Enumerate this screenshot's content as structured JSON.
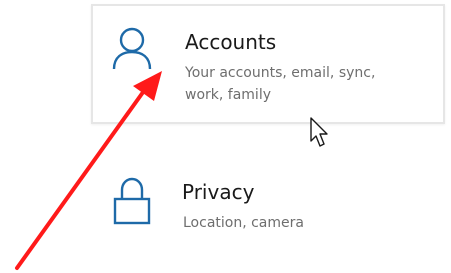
{
  "settings": {
    "accounts": {
      "title": "Accounts",
      "description_line1": "Your accounts, email, sync,",
      "description_line2": "work, family",
      "icon": "person-icon"
    },
    "privacy": {
      "title": "Privacy",
      "description": "Location, camera",
      "icon": "lock-icon"
    }
  },
  "annotation": {
    "arrow_color": "#ff1a1a",
    "target": "accounts"
  },
  "colors": {
    "accent": "#1e6aa8",
    "title": "#1a1a1a",
    "subtitle": "#6e6e6e",
    "tile_border": "#e6e6e6"
  }
}
